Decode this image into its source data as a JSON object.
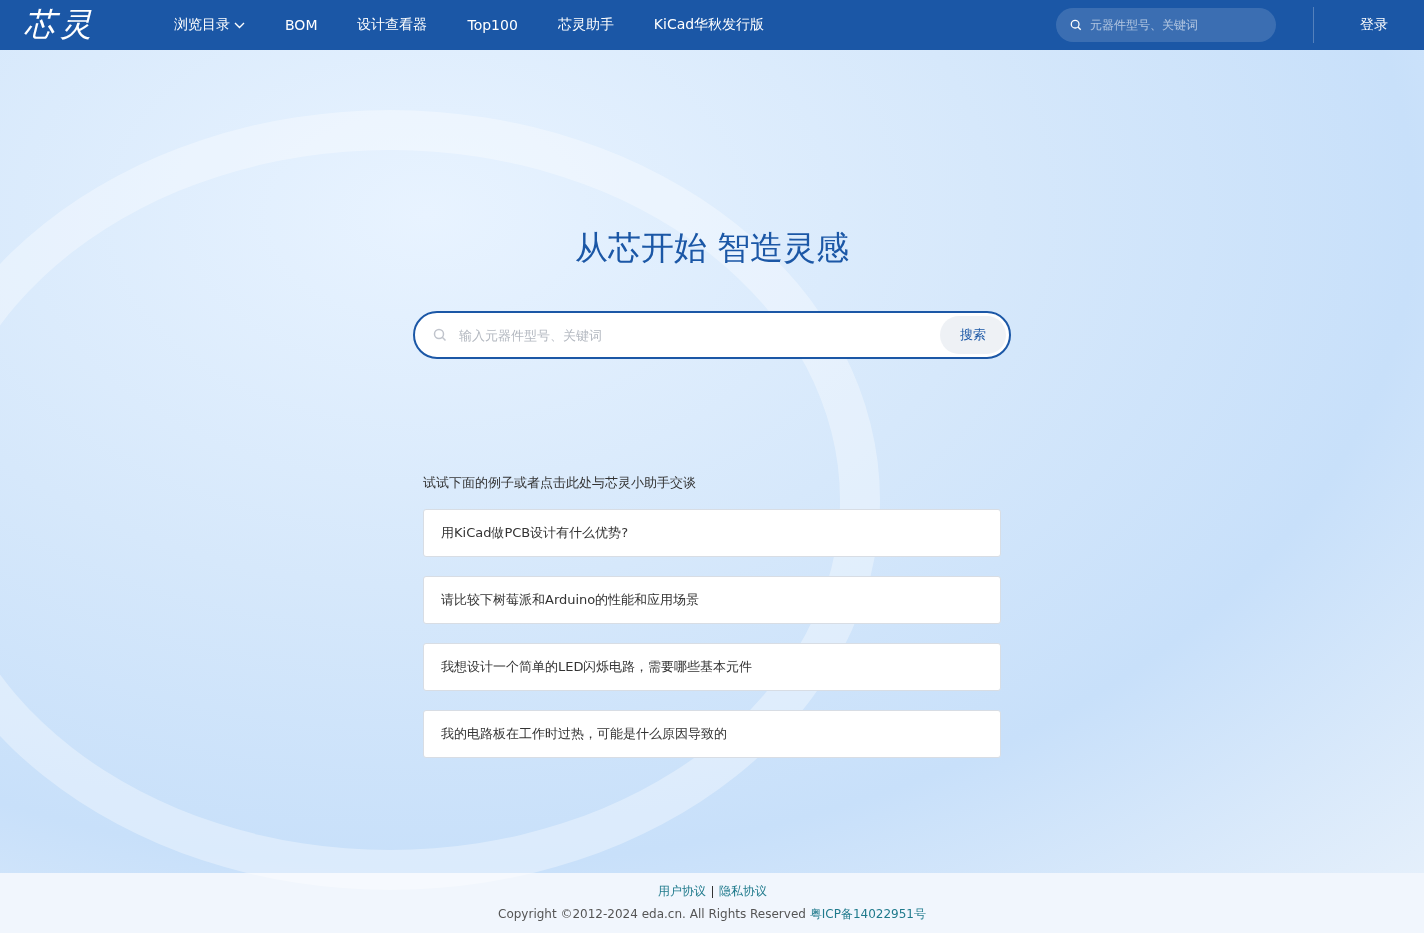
{
  "header": {
    "logo": "芯灵",
    "nav": [
      {
        "label": "浏览目录",
        "dropdown": true
      },
      {
        "label": "BOM",
        "dropdown": false
      },
      {
        "label": "设计查看器",
        "dropdown": false
      },
      {
        "label": "Top100",
        "dropdown": false
      },
      {
        "label": "芯灵助手",
        "dropdown": false
      },
      {
        "label": "KiCad华秋发行版",
        "dropdown": false
      }
    ],
    "search": {
      "placeholder": "元器件型号、关键词"
    },
    "login": "登录"
  },
  "hero": {
    "title": "从芯开始 智造灵感",
    "search": {
      "placeholder": "输入元器件型号、关键词",
      "button": "搜索"
    }
  },
  "examples": {
    "hint": "试试下面的例子或者点击此处与芯灵小助手交谈",
    "items": [
      "用KiCad做PCB设计有什么优势?",
      "请比较下树莓派和Arduino的性能和应用场景",
      "我想设计一个简单的LED闪烁电路，需要哪些基本元件",
      "我的电路板在工作时过热，可能是什么原因导致的"
    ]
  },
  "footer": {
    "links": [
      "用户协议",
      "隐私协议"
    ],
    "copyright": "Copyright ©2012-2024 eda.cn. All Rights Reserved",
    "icp": "粤ICP备14022951号"
  }
}
